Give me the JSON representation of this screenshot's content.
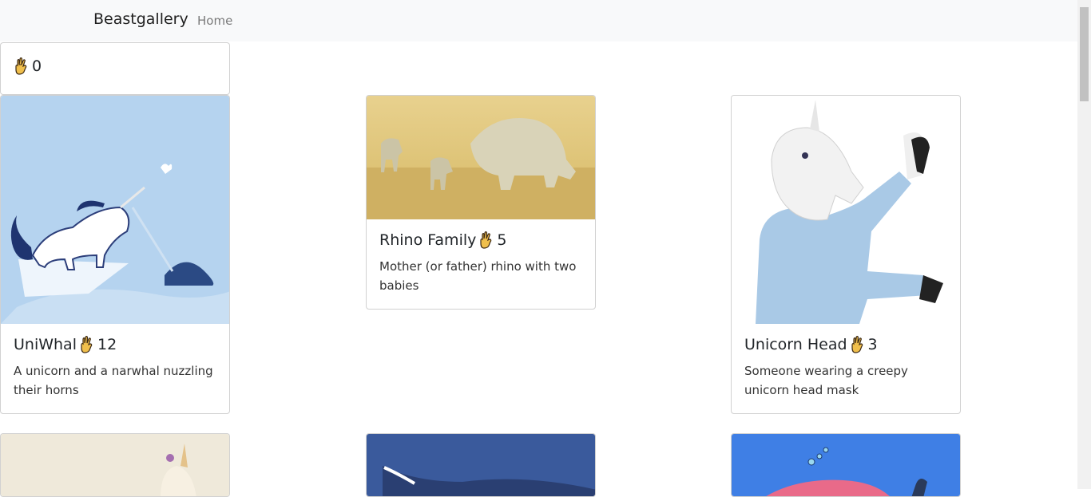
{
  "navbar": {
    "brand": "Beastgallery",
    "home_label": "Home"
  },
  "counter_card": {
    "count": "0"
  },
  "cards": [
    {
      "title": "UniWhal",
      "count": "12",
      "description": "A unicorn and a narwhal nuzzling their horns"
    },
    {
      "title": "Rhino Family",
      "count": "5",
      "description": "Mother (or father) rhino with two babies"
    },
    {
      "title": "Unicorn Head",
      "count": "3",
      "description": "Someone wearing a creepy unicorn head mask"
    }
  ],
  "icons": {
    "vote": "crossed-fingers-icon"
  },
  "colors": {
    "navbar_bg": "#f8f9fa",
    "hand": "#f0bf4c",
    "uniwhal_bg": "#b5d3ef",
    "rhino_bg": "#e0c47a",
    "shark_bg": "#3a5a9c",
    "whale_bg": "#3f7fe5"
  }
}
